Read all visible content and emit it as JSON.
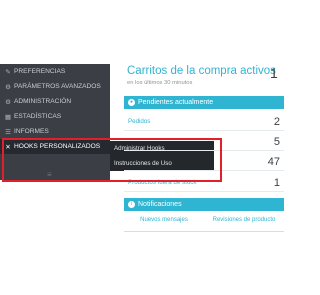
{
  "sidebar": {
    "items": [
      {
        "label": "PREFERENCIAS",
        "icon": "wrench-icon",
        "glyph": "🔧"
      },
      {
        "label": "PARÁMETROS AVANZADOS",
        "icon": "cogs-icon",
        "glyph": "⚙"
      },
      {
        "label": "ADMINISTRACIÓN",
        "icon": "gear-icon",
        "glyph": "⚙"
      },
      {
        "label": "ESTADÍSTICAS",
        "icon": "chart-icon",
        "glyph": "▦"
      },
      {
        "label": "INFORMES",
        "icon": "list-icon",
        "glyph": "☰"
      },
      {
        "label": "HOOKS PERSONALIZADOS",
        "icon": "shuffle-icon",
        "glyph": "⤨"
      }
    ],
    "collapse_glyph": "≡"
  },
  "submenu": {
    "items": [
      "Administrar Hooks",
      "Instrucciones de Uso"
    ]
  },
  "panel": {
    "title": "Carritos de la compra activos",
    "subtitle": "en los últimos 30 minutos",
    "count": "1"
  },
  "pending": {
    "header": "Pendientes actualmente",
    "rows": [
      {
        "label": "Pedidos",
        "value": "2"
      },
      {
        "label": "",
        "value": "5"
      },
      {
        "label": "",
        "value": "47"
      },
      {
        "label": "Productos fuera de stock",
        "value": "1"
      }
    ]
  },
  "notifications": {
    "header": "Notificaciones",
    "tabs": [
      "Nuevos mensajes",
      "Revisiones de producto"
    ]
  },
  "colors": {
    "accent": "#2fb5d2",
    "sidebar_bg": "#3b3e44",
    "highlight": "#e2202a"
  }
}
